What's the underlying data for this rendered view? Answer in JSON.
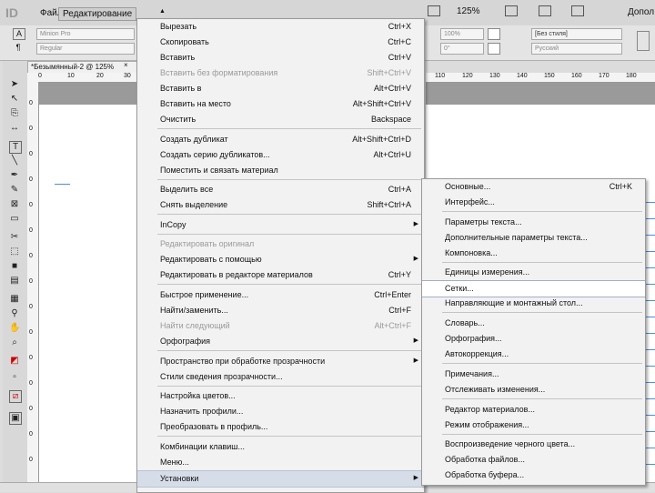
{
  "app": {
    "logo": "ID",
    "menus": [
      {
        "label": "Файл"
      },
      {
        "label": "Редактирование"
      }
    ],
    "zoom": "125%",
    "workspace": "Допол"
  },
  "control_bar": {
    "font_field": "Minion Pro",
    "style_field": "Regular",
    "scale_value": "100%",
    "angle_value": "0°",
    "char_style": "[Без стиля]",
    "language": "Русский"
  },
  "document": {
    "tab_title": "*Безымянный-2 @ 125%",
    "close": "×",
    "ruler_top": [
      "0",
      "10",
      "20",
      "30"
    ],
    "ruler_top_right": [
      "110",
      "120",
      "130",
      "140",
      "150",
      "160",
      "170",
      "180"
    ],
    "ruler_left": [
      "0",
      "0",
      "0",
      "0",
      "0",
      "0",
      "0",
      "0",
      "0",
      "0",
      "0",
      "0",
      "0",
      "0",
      "0"
    ]
  },
  "edit_menu": {
    "items": [
      {
        "label": "Вырезать",
        "shortcut": "Ctrl+X",
        "disabled": false,
        "submenu": false
      },
      {
        "label": "Скопировать",
        "shortcut": "Ctrl+C",
        "disabled": false,
        "submenu": false
      },
      {
        "label": "Вставить",
        "shortcut": "Ctrl+V",
        "disabled": false,
        "submenu": false
      },
      {
        "label": "Вставить без форматирования",
        "shortcut": "Shift+Ctrl+V",
        "disabled": true,
        "submenu": false
      },
      {
        "label": "Вставить в",
        "shortcut": "Alt+Ctrl+V",
        "disabled": false,
        "submenu": false
      },
      {
        "label": "Вставить на место",
        "shortcut": "Alt+Shift+Ctrl+V",
        "disabled": false,
        "submenu": false
      },
      {
        "label": "Очистить",
        "shortcut": "Backspace",
        "disabled": false,
        "submenu": false,
        "sep_after": true
      },
      {
        "label": "Создать дубликат",
        "shortcut": "Alt+Shift+Ctrl+D",
        "disabled": false,
        "submenu": false
      },
      {
        "label": "Создать серию дубликатов...",
        "shortcut": "Alt+Ctrl+U",
        "disabled": false,
        "submenu": false
      },
      {
        "label": "Поместить и связать материал",
        "shortcut": "",
        "disabled": false,
        "submenu": false,
        "sep_after": true
      },
      {
        "label": "Выделить все",
        "shortcut": "Ctrl+A",
        "disabled": false,
        "submenu": false
      },
      {
        "label": "Снять выделение",
        "shortcut": "Shift+Ctrl+A",
        "disabled": false,
        "submenu": false,
        "sep_after": true
      },
      {
        "label": "InCopy",
        "shortcut": "",
        "disabled": false,
        "submenu": true,
        "sep_after": true
      },
      {
        "label": "Редактировать оригинал",
        "shortcut": "",
        "disabled": true,
        "submenu": false
      },
      {
        "label": "Редактировать с помощью",
        "shortcut": "",
        "disabled": false,
        "submenu": true
      },
      {
        "label": "Редактировать в редакторе материалов",
        "shortcut": "Ctrl+Y",
        "disabled": false,
        "submenu": false,
        "sep_after": true
      },
      {
        "label": "Быстрое применение...",
        "shortcut": "Ctrl+Enter",
        "disabled": false,
        "submenu": false
      },
      {
        "label": "Найти/заменить...",
        "shortcut": "Ctrl+F",
        "disabled": false,
        "submenu": false
      },
      {
        "label": "Найти следующий",
        "shortcut": "Alt+Ctrl+F",
        "disabled": true,
        "submenu": false
      },
      {
        "label": "Орфография",
        "shortcut": "",
        "disabled": false,
        "submenu": true,
        "sep_after": true
      },
      {
        "label": "Пространство при обработке прозрачности",
        "shortcut": "",
        "disabled": false,
        "submenu": true
      },
      {
        "label": "Стили сведения прозрачности...",
        "shortcut": "",
        "disabled": false,
        "submenu": false,
        "sep_after": true
      },
      {
        "label": "Настройка цветов...",
        "shortcut": "",
        "disabled": false,
        "submenu": false
      },
      {
        "label": "Назначить профили...",
        "shortcut": "",
        "disabled": false,
        "submenu": false
      },
      {
        "label": "Преобразовать в профиль...",
        "shortcut": "",
        "disabled": false,
        "submenu": false,
        "sep_after": true
      },
      {
        "label": "Комбинации клавиш...",
        "shortcut": "",
        "disabled": false,
        "submenu": false
      },
      {
        "label": "Меню...",
        "shortcut": "",
        "disabled": false,
        "submenu": false
      },
      {
        "label": "Установки",
        "shortcut": "",
        "disabled": false,
        "submenu": true,
        "highlighted": true
      }
    ]
  },
  "prefs_submenu": {
    "items": [
      {
        "label": "Основные...",
        "shortcut": "Ctrl+K"
      },
      {
        "label": "Интерфейс...",
        "shortcut": "",
        "sep_after": true
      },
      {
        "label": "Параметры текста...",
        "shortcut": ""
      },
      {
        "label": "Дополнительные параметры текста...",
        "shortcut": ""
      },
      {
        "label": "Компоновка...",
        "shortcut": "",
        "sep_after": true
      },
      {
        "label": "Единицы измерения...",
        "shortcut": ""
      },
      {
        "label": "Сетки...",
        "shortcut": "",
        "highlighted": true
      },
      {
        "label": "Направляющие и монтажный стол...",
        "shortcut": "",
        "sep_after": true
      },
      {
        "label": "Словарь...",
        "shortcut": ""
      },
      {
        "label": "Орфография...",
        "shortcut": ""
      },
      {
        "label": "Автокоррекция...",
        "shortcut": "",
        "sep_after": true
      },
      {
        "label": "Примечания...",
        "shortcut": ""
      },
      {
        "label": "Отслеживать изменения...",
        "shortcut": "",
        "sep_after": true
      },
      {
        "label": "Редактор материалов...",
        "shortcut": ""
      },
      {
        "label": "Режим отображения...",
        "shortcut": "",
        "sep_after": true
      },
      {
        "label": "Воспроизведение черного цвета...",
        "shortcut": ""
      },
      {
        "label": "Обработка файлов...",
        "shortcut": ""
      },
      {
        "label": "Обработка буфера...",
        "shortcut": ""
      }
    ]
  },
  "colors": {
    "highlight": "#d6dde8",
    "guide": "#4d8fd6",
    "disabled": "#9a9a9a"
  }
}
